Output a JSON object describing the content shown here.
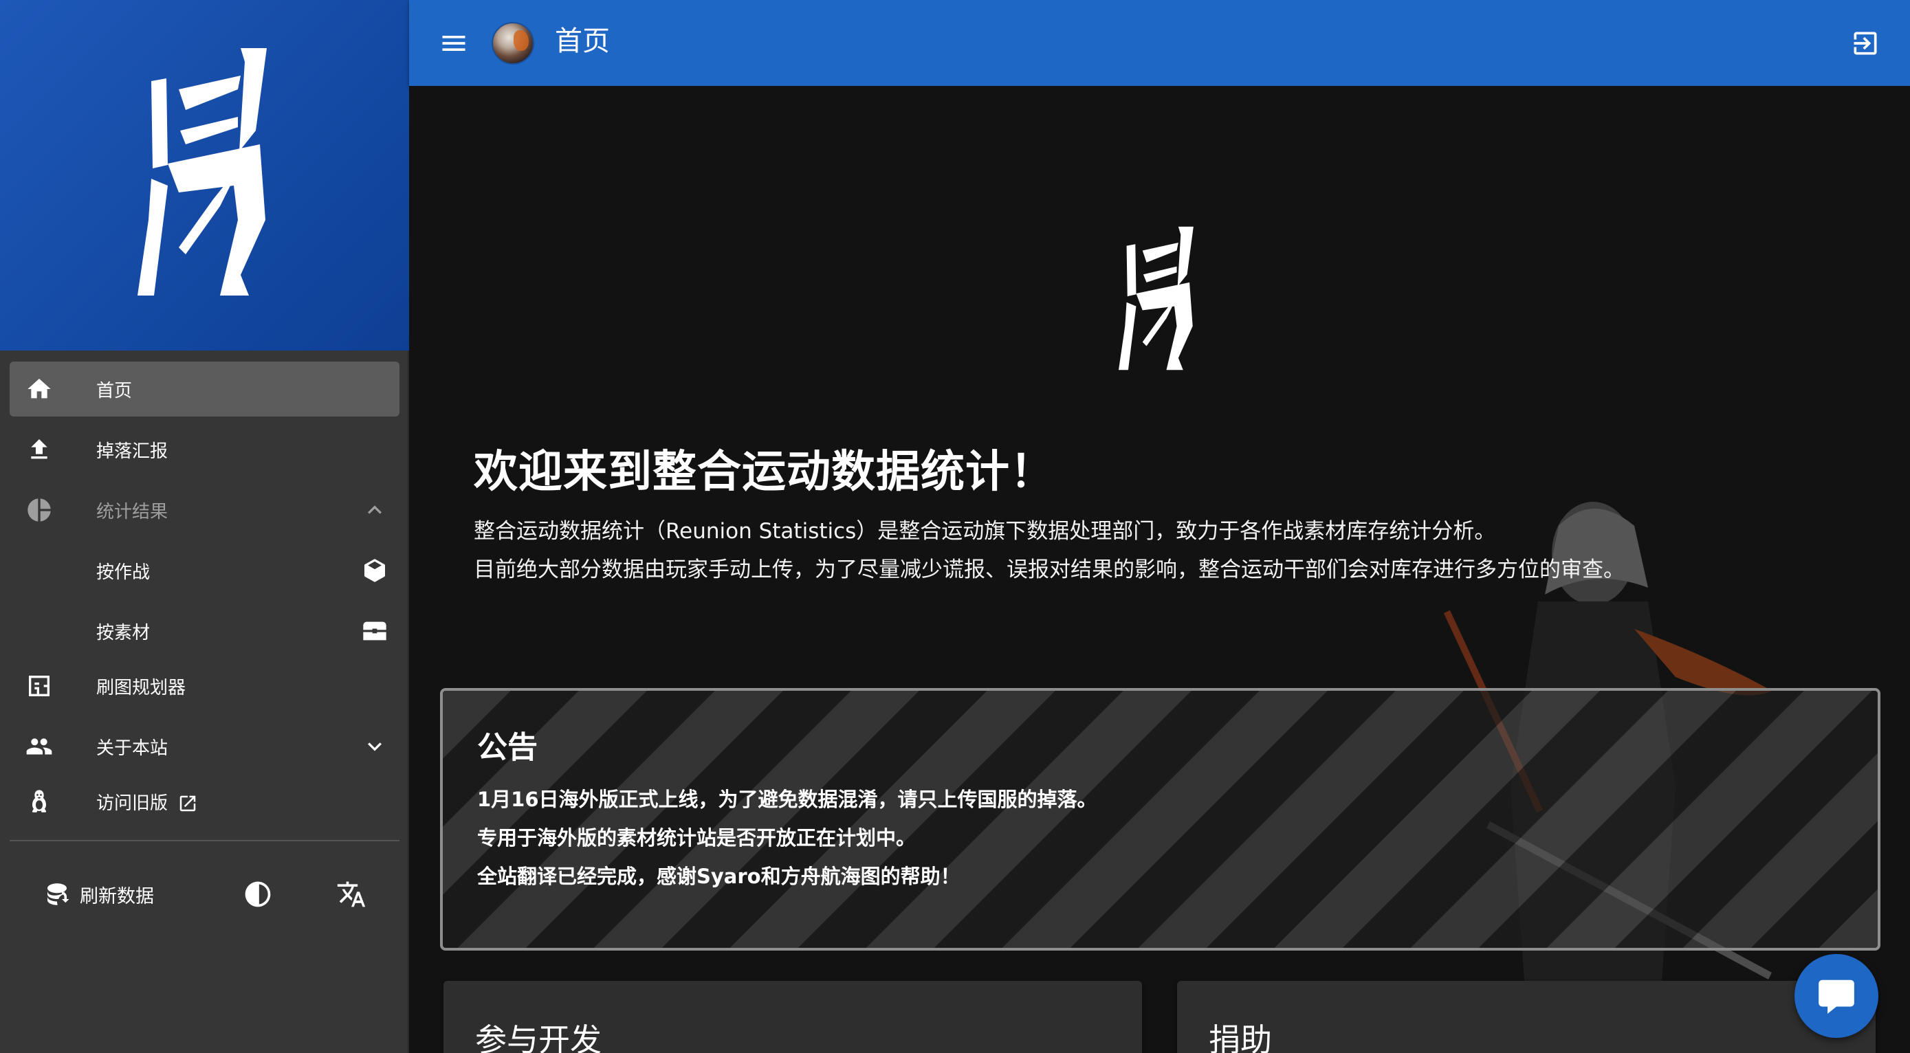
{
  "header": {
    "title": "首页",
    "menu_icon": "menu-icon",
    "logout_icon": "logout-icon"
  },
  "sidebar": {
    "items": [
      {
        "label": "首页",
        "icon": "home-icon",
        "active": true
      },
      {
        "label": "掉落汇报",
        "icon": "upload-icon"
      },
      {
        "label": "统计结果",
        "icon": "pie-chart-icon",
        "expanded": true
      },
      {
        "label": "按作战",
        "icon": "cube-icon"
      },
      {
        "label": "按素材",
        "icon": "treasure-chest-icon"
      },
      {
        "label": "刷图规划器",
        "icon": "floor-plan-icon"
      },
      {
        "label": "关于本站",
        "icon": "people-icon",
        "expanded": false
      },
      {
        "label": "访问旧版",
        "icon": "penguin-icon",
        "external": true
      }
    ],
    "actions": {
      "refresh_label": "刷新数据",
      "theme_icon": "contrast-icon",
      "language_icon": "translate-icon"
    }
  },
  "main": {
    "welcome_title": "欢迎来到整合运动数据统计！",
    "welcome_lines": [
      "整合运动数据统计（Reunion Statistics）是整合运动旗下数据处理部门，致力于各作战素材库存统计分析。",
      "目前绝大部分数据由玩家手动上传，为了尽量减少谎报、误报对结果的影响，整合运动干部们会对库存进行多方位的审查。"
    ],
    "announcement": {
      "title": "公告",
      "lines": [
        "1月16日海外版正式上线，为了避免数据混淆，请只上传国服的掉落。",
        "专用于海外版的素材统计站是否开放正在计划中。",
        "全站翻译已经完成，感谢Syaro和方舟航海图的帮助！"
      ]
    },
    "cards": {
      "contribute_title": "参与开发",
      "donate_title": "捐助"
    }
  },
  "colors": {
    "primary": "#1f67c4",
    "sidebar": "#363636",
    "background": "#121212"
  }
}
